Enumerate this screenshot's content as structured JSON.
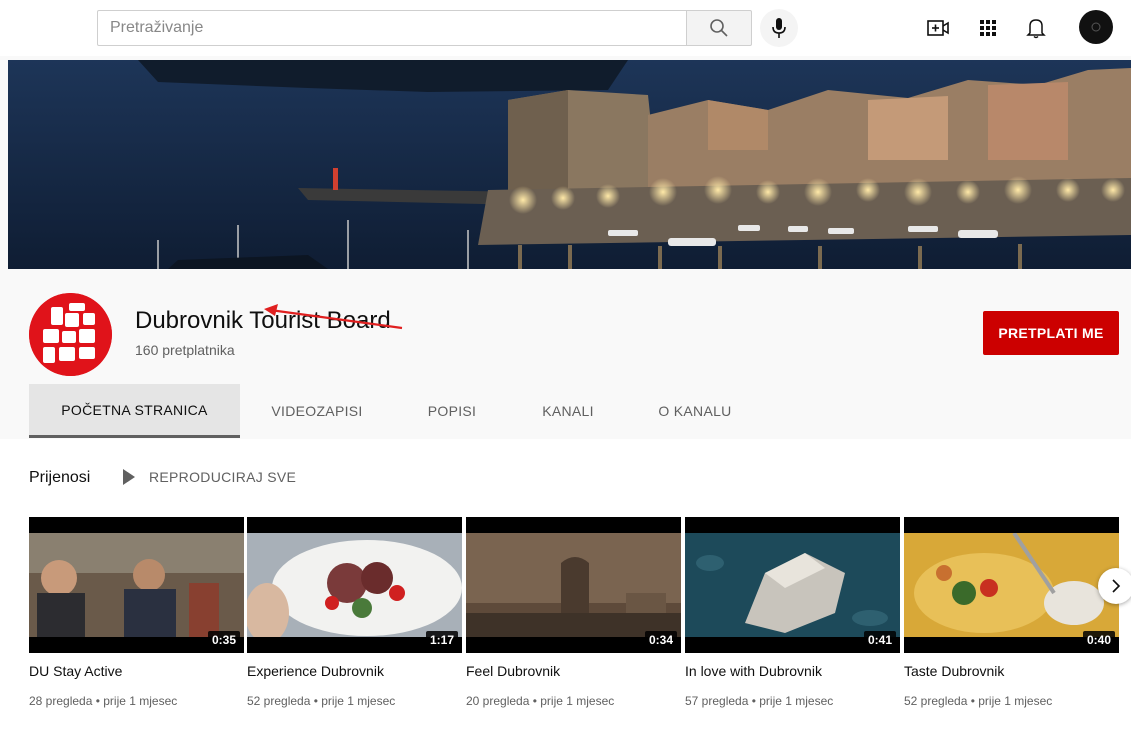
{
  "search": {
    "placeholder": "Pretraživanje"
  },
  "header_icons": [
    "search-icon",
    "mic-icon",
    "create-video-icon",
    "apps-grid-icon",
    "notifications-bell-icon",
    "account-avatar"
  ],
  "channel": {
    "name": "Dubrovnik Tourist Board",
    "subscribers": "160 pretplatnika",
    "subscribe_label": "PRETPLATI ME",
    "logo_text": "DU BRO VNIK",
    "brand_color": "#cc0000"
  },
  "tabs": [
    {
      "label": "POČETNA STRANICA",
      "active": true
    },
    {
      "label": "VIDEOZAPISI",
      "active": false
    },
    {
      "label": "POPISI",
      "active": false
    },
    {
      "label": "KANALI",
      "active": false
    },
    {
      "label": "O KANALU",
      "active": false
    }
  ],
  "uploads": {
    "title": "Prijenosi",
    "play_all": "REPRODUCIRAJ SVE",
    "videos": [
      {
        "title": "DU Stay Active",
        "duration": "0:35",
        "meta": "28 pregleda • prije 1 mjesec"
      },
      {
        "title": "Experience Dubrovnik",
        "duration": "1:17",
        "meta": "52 pregleda • prije 1 mjesec"
      },
      {
        "title": "Feel Dubrovnik",
        "duration": "0:34",
        "meta": "20 pregleda • prije 1 mjesec"
      },
      {
        "title": "In love with Dubrovnik",
        "duration": "0:41",
        "meta": "57 pregleda • prije 1 mjesec"
      },
      {
        "title": "Taste Dubrovnik",
        "duration": "0:40",
        "meta": "52 pregleda • prije 1 mjesec"
      }
    ]
  }
}
